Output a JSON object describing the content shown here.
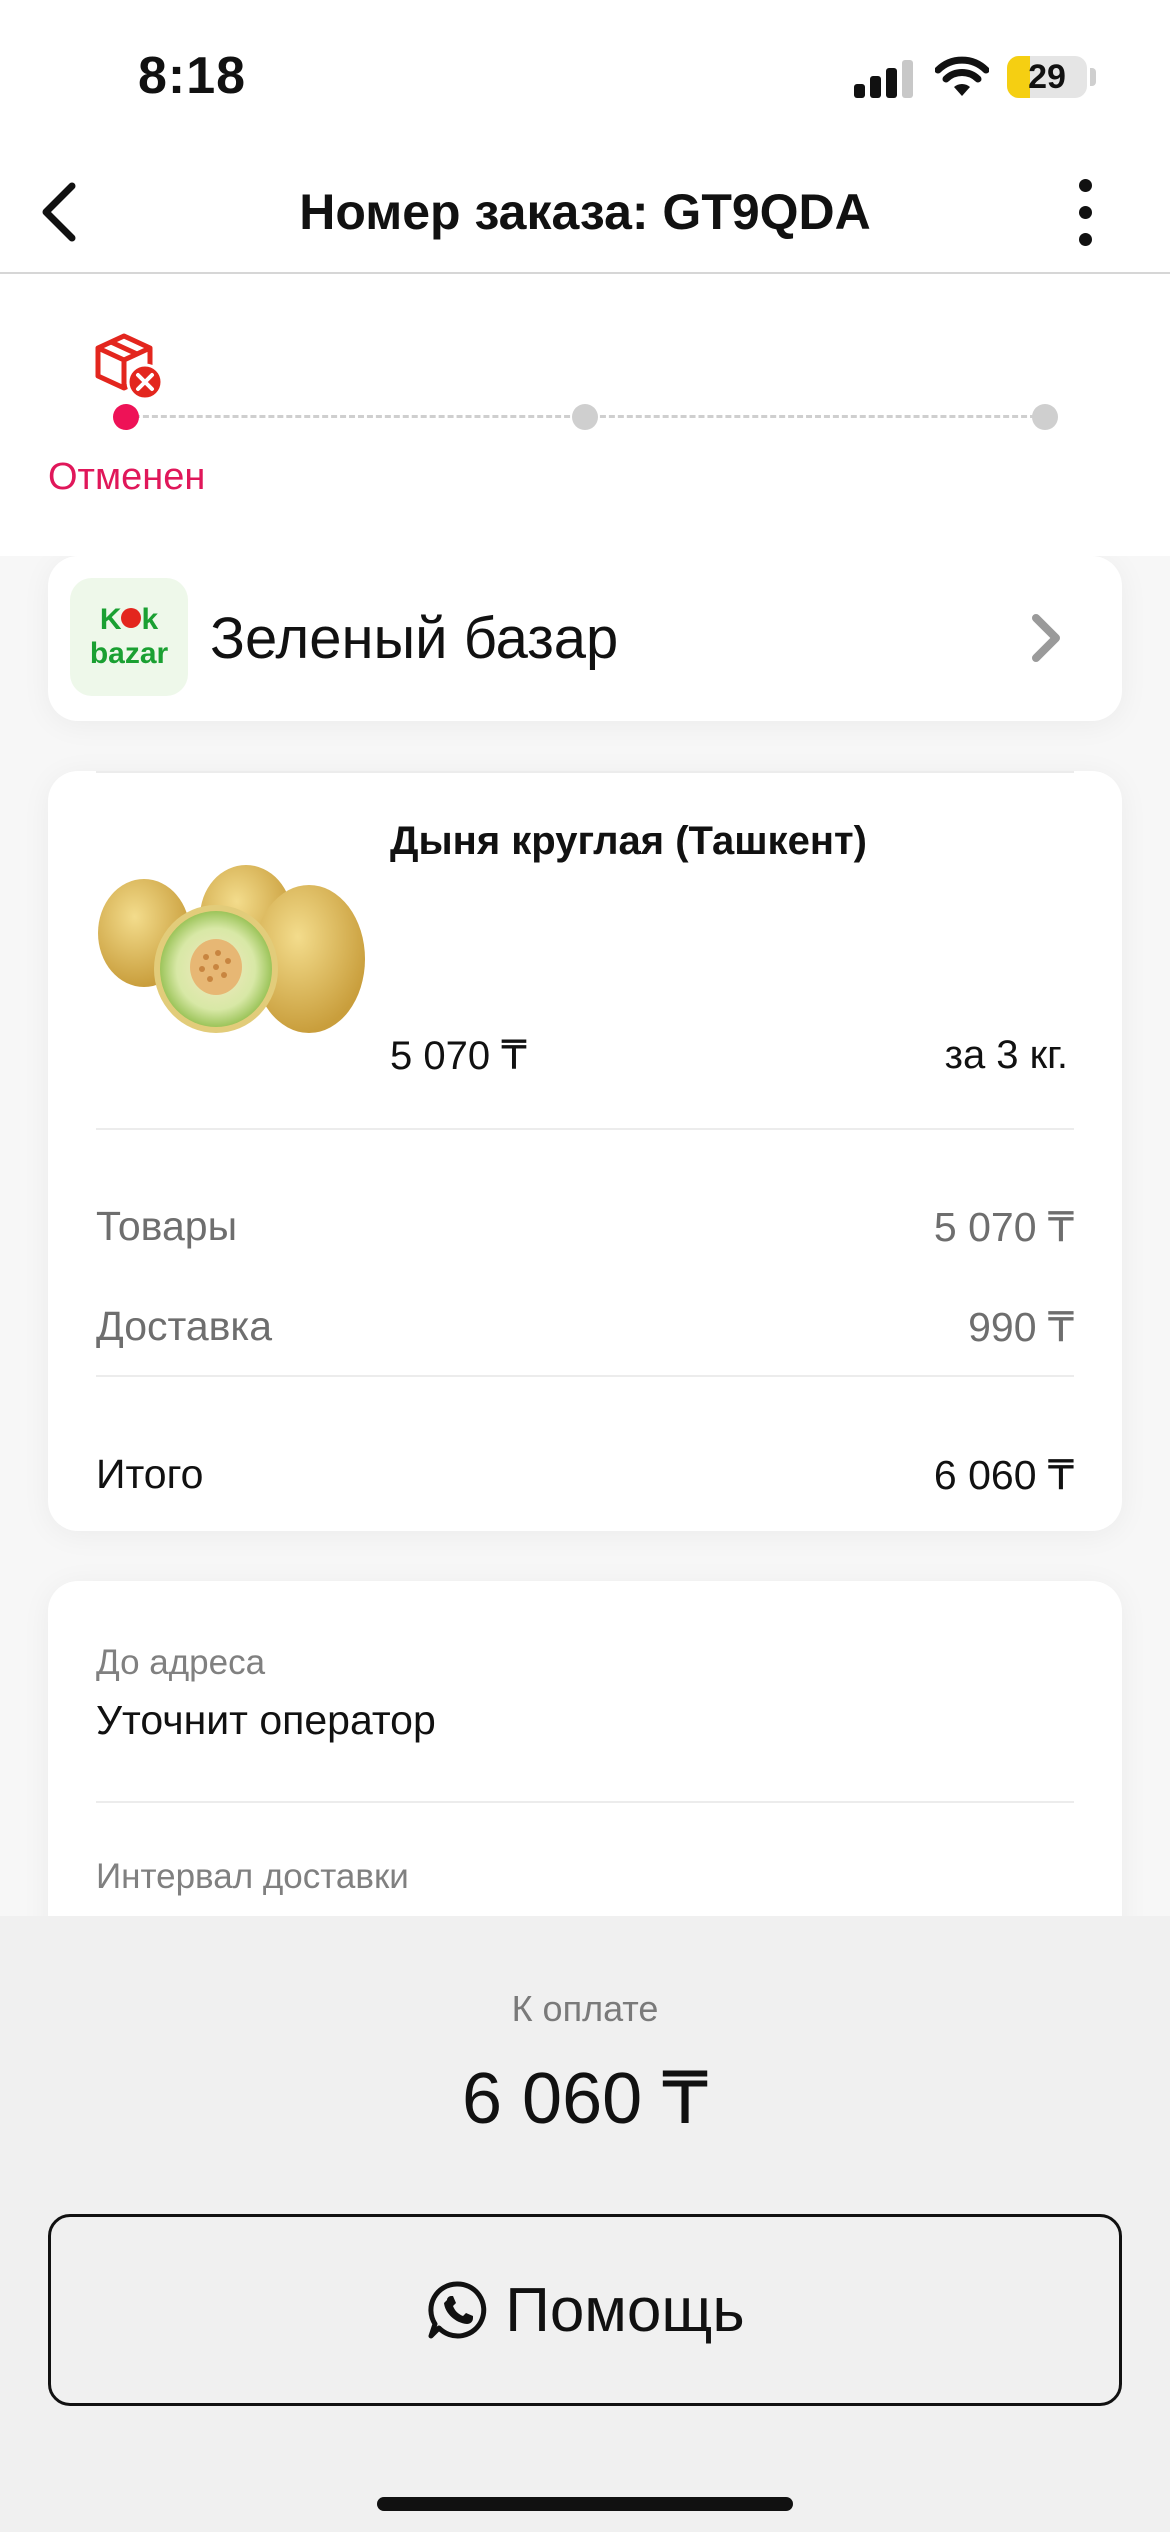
{
  "status_bar": {
    "time": "8:18",
    "battery": "29",
    "battery_level": 0.29,
    "battery_color": "#f5cf12"
  },
  "header": {
    "title": "Номер заказа: GT9QDA",
    "back_icon": "chevron-left-icon",
    "menu_icon": "more-vertical-icon"
  },
  "tracker": {
    "status": "Отменен",
    "status_icon": "box-cancelled-icon",
    "active_color": "#ee1257",
    "inactive_color": "#cfcfcf",
    "current_step": 1,
    "total_steps": 3
  },
  "store": {
    "logo_line1_a": "K",
    "logo_line1_b": "k",
    "logo_line2": "bazar",
    "name": "Зеленый базар",
    "chevron_icon": "chevron-right-icon"
  },
  "order": {
    "product": {
      "name": "Дыня круглая (Ташкент)",
      "price": "5 070 ₸",
      "quantity": "за 3 кг.",
      "image_icon": "melon-image"
    },
    "summary": [
      {
        "label": "Товары",
        "value": "5 070 ₸"
      },
      {
        "label": "Доставка",
        "value": "990 ₸"
      }
    ],
    "total": {
      "label": "Итого",
      "value": "6 060 ₸"
    }
  },
  "delivery": {
    "address_label": "До адреса",
    "address_value": "Уточнит оператор",
    "interval_label": "Интервал доставки"
  },
  "payment": {
    "label": "К оплате",
    "amount": "6 060 ₸"
  },
  "help_button": {
    "label": "Помощь",
    "icon": "whatsapp-icon"
  }
}
